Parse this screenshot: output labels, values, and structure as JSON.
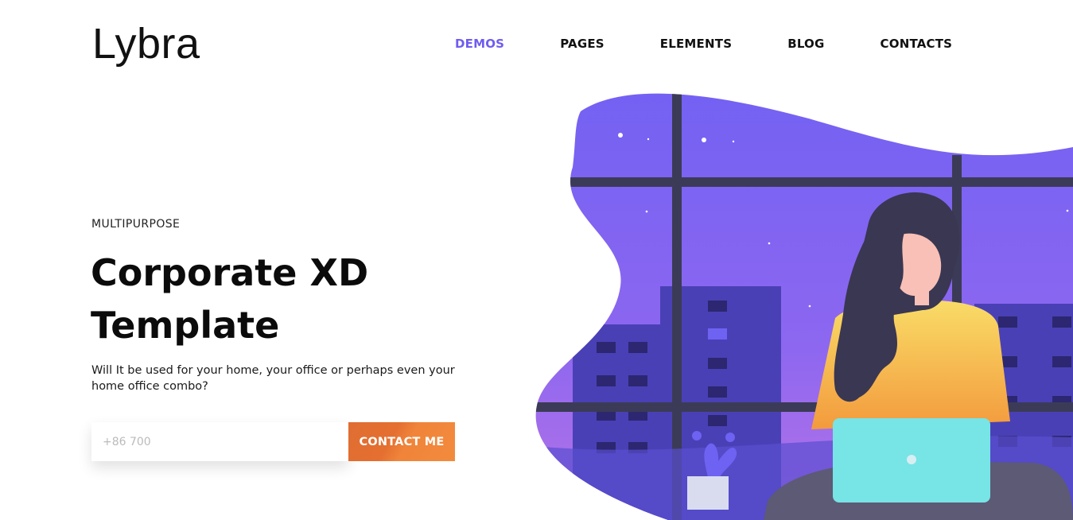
{
  "brand": {
    "logo_text": "Lybra"
  },
  "nav": {
    "items": [
      {
        "label": "DEMOS",
        "active": true
      },
      {
        "label": "PAGES",
        "active": false
      },
      {
        "label": "ELEMENTS",
        "active": false
      },
      {
        "label": "BLOG",
        "active": false
      },
      {
        "label": "CONTACTS",
        "active": false
      }
    ]
  },
  "hero": {
    "eyebrow": "MULTIPURPOSE",
    "title_line1": "Corporate XD",
    "title_line2": "Template",
    "description": "Will It be used for your home, your office or perhaps even your home office combo?",
    "phone_placeholder": "+86 700",
    "cta_label": "CONTACT ME"
  },
  "colors": {
    "accent": "#6f5cf0",
    "cta": "#e8773a",
    "sky_top": "#7b63f4",
    "sky_bottom": "#b06de8",
    "building": "#4a3fb0",
    "laptop": "#77e4e6",
    "sweater": "#f8c85a",
    "hair": "#3b3654"
  },
  "illustration": {
    "name": "woman-with-laptop-at-night-window"
  }
}
